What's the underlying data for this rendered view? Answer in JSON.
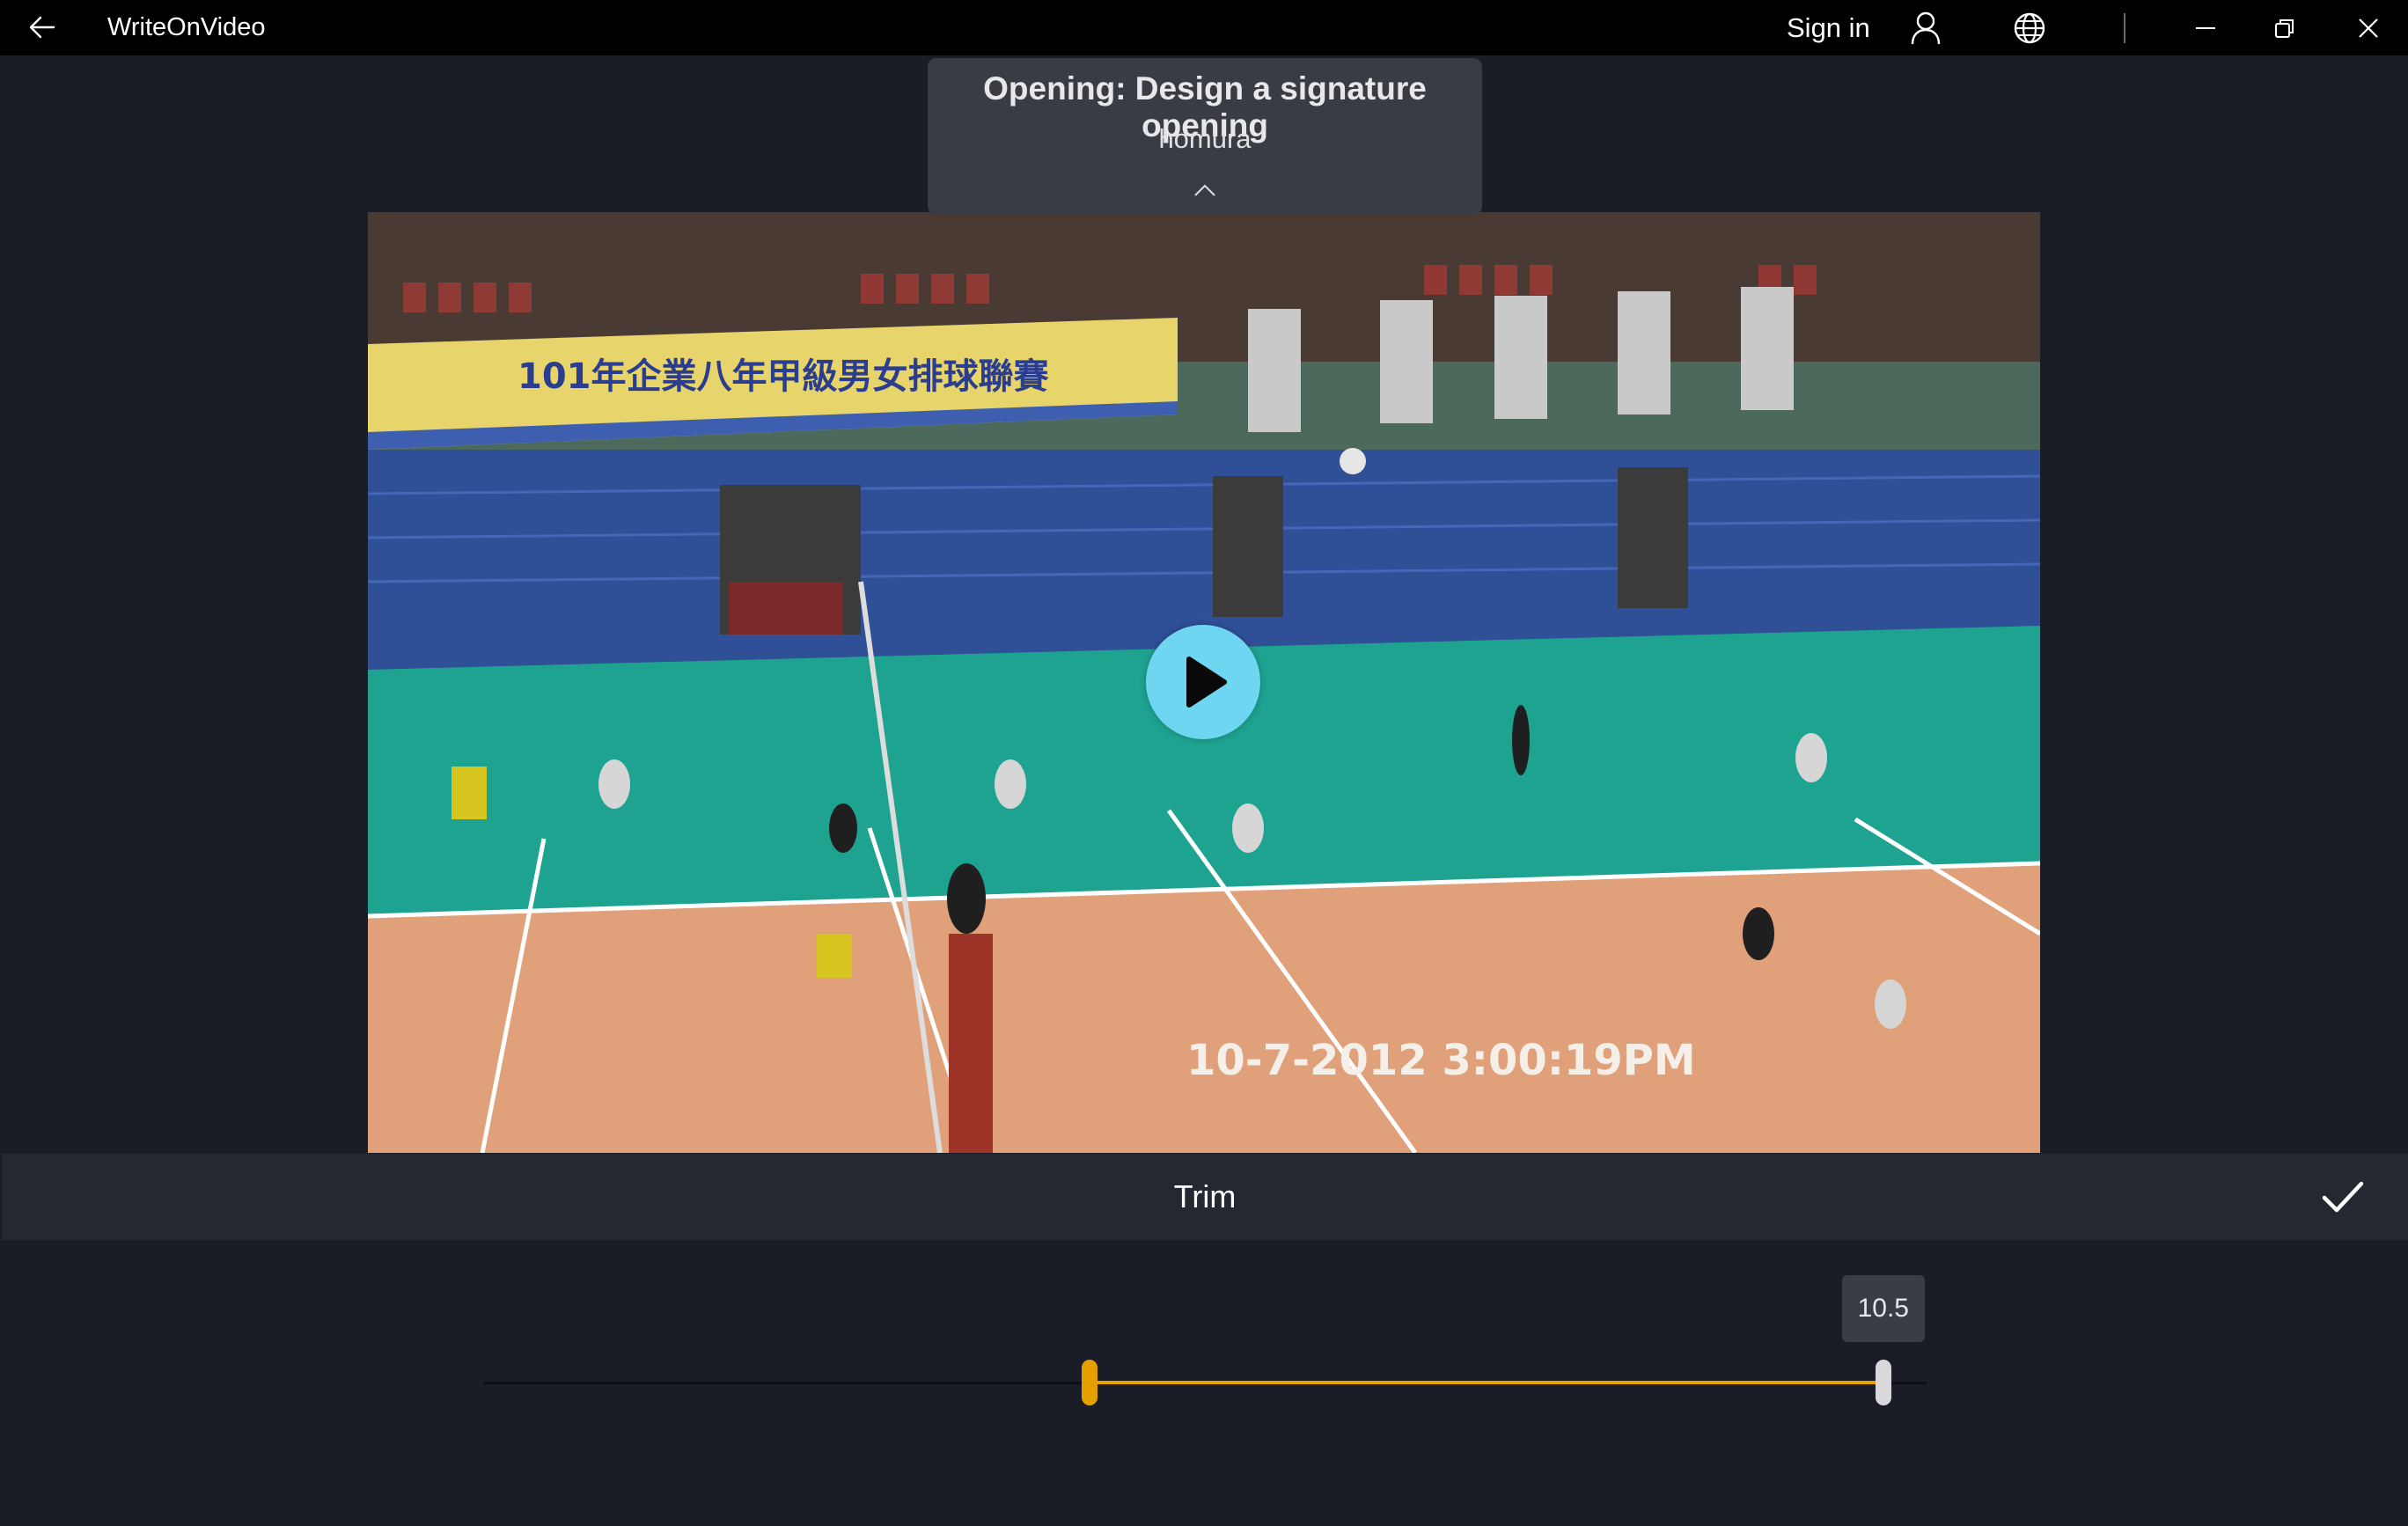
{
  "window": {
    "title": "WriteOnVideo",
    "sign_in_label": "Sign in",
    "icons": {
      "back": "back-arrow-icon",
      "account": "person-icon",
      "language": "globe-icon",
      "minimize": "minimize-icon",
      "restore": "restore-icon",
      "close": "close-icon"
    }
  },
  "template_card": {
    "title": "Opening: Design a signature opening",
    "author": "homura",
    "collapse_icon": "chevron-up-icon"
  },
  "video": {
    "overlay_timestamp": "10-7-2012   3:00:19PM",
    "banner_text": "101年企業八年甲級男女排球聯賽",
    "play_icon": "play-icon",
    "play_button_color": "#6fd6f2"
  },
  "trim_panel": {
    "title": "Trim",
    "confirm_icon": "checkmark-icon",
    "range_start_fraction": 0.42,
    "range_end_fraction": 0.97,
    "end_value_label": "10.5",
    "accent_color": "#e5a000"
  }
}
